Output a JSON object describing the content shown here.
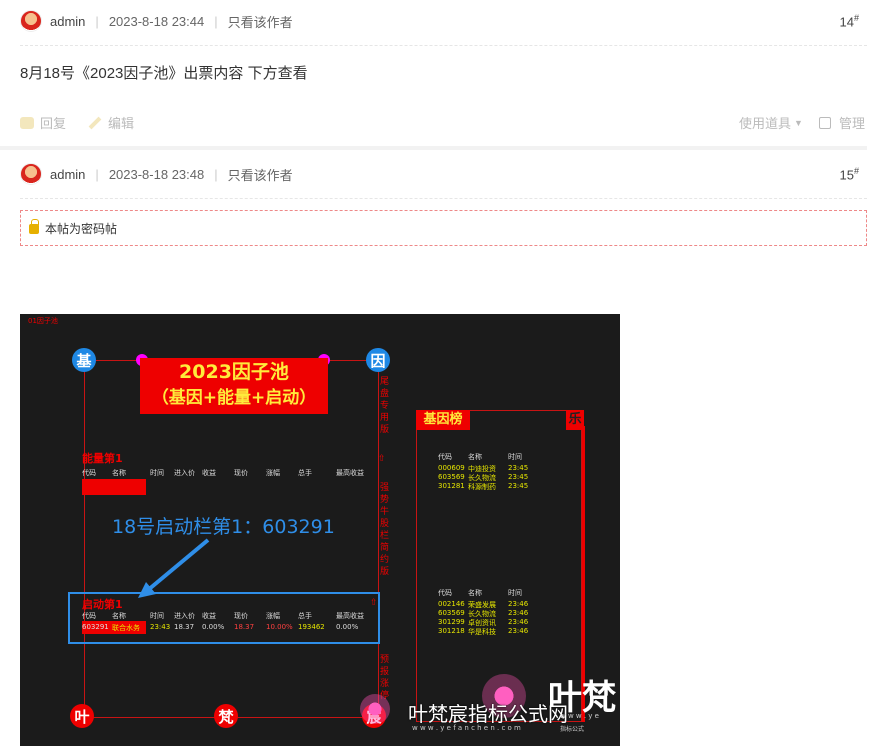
{
  "post1": {
    "author": "admin",
    "datetime": "2023-8-18 23:44",
    "only_author": "只看该作者",
    "floor": "14",
    "floor_mark": "#",
    "content": "8月18号《2023因子池》出票内容  下方查看",
    "reply": "回复",
    "edit": "编辑",
    "use_tools": "使用道具",
    "manage": "管理"
  },
  "post2": {
    "author": "admin",
    "datetime": "2023-8-18 23:48",
    "only_author": "只看该作者",
    "floor": "15",
    "floor_mark": "#",
    "locked_notice": "本帖为密码帖"
  },
  "image": {
    "corner_label": "01因子池",
    "title_line1": "2023因子池",
    "title_line2": "（基因+能量+启动）",
    "circle_tl": "基",
    "circle_tr": "因",
    "circle_bl": "叶",
    "circle_bm": "梵",
    "circle_br": "宸",
    "side_text_1": "尾盘专用版",
    "side_text_2": "强势牛股栏",
    "side_text_3": "简约版",
    "side_text_4": "预报涨停",
    "energy_title": "能量第1",
    "table_headers": [
      "代码",
      "名称",
      "时间",
      "进入价",
      "收益",
      "现价",
      "涨幅",
      "总手",
      "最高收益"
    ],
    "annotation": "18号启动栏第1：603291",
    "launch_title": "启动第1",
    "launch_row": [
      "603291",
      "联合水务",
      "23:43",
      "18.37",
      "0.00%",
      "18.37",
      "10.00%",
      "193462",
      "0.00%"
    ],
    "gene_title": "基因榜",
    "gene_box": "乐",
    "gene_headers": [
      "代码",
      "名称",
      "时间"
    ],
    "gene_rows_1": [
      [
        "000609",
        "中迪投资",
        "23:45"
      ],
      [
        "603569",
        "长久物流",
        "23:45"
      ],
      [
        "301281",
        "科源制药",
        "23:45"
      ]
    ],
    "gene_rows_2": [
      [
        "002146",
        "荣盛发展",
        "23:46"
      ],
      [
        "603569",
        "长久物流",
        "23:46"
      ],
      [
        "301299",
        "卓创资讯",
        "23:46"
      ],
      [
        "301218",
        "华是科技",
        "23:46"
      ]
    ],
    "watermark": "叶梵宸指标公式网",
    "watermark_url": "w w w . y e f a n c h e n . c o m",
    "watermark_big": "叶梵",
    "watermark_small": "w w w . y e",
    "watermark_tag": "指标公式"
  }
}
